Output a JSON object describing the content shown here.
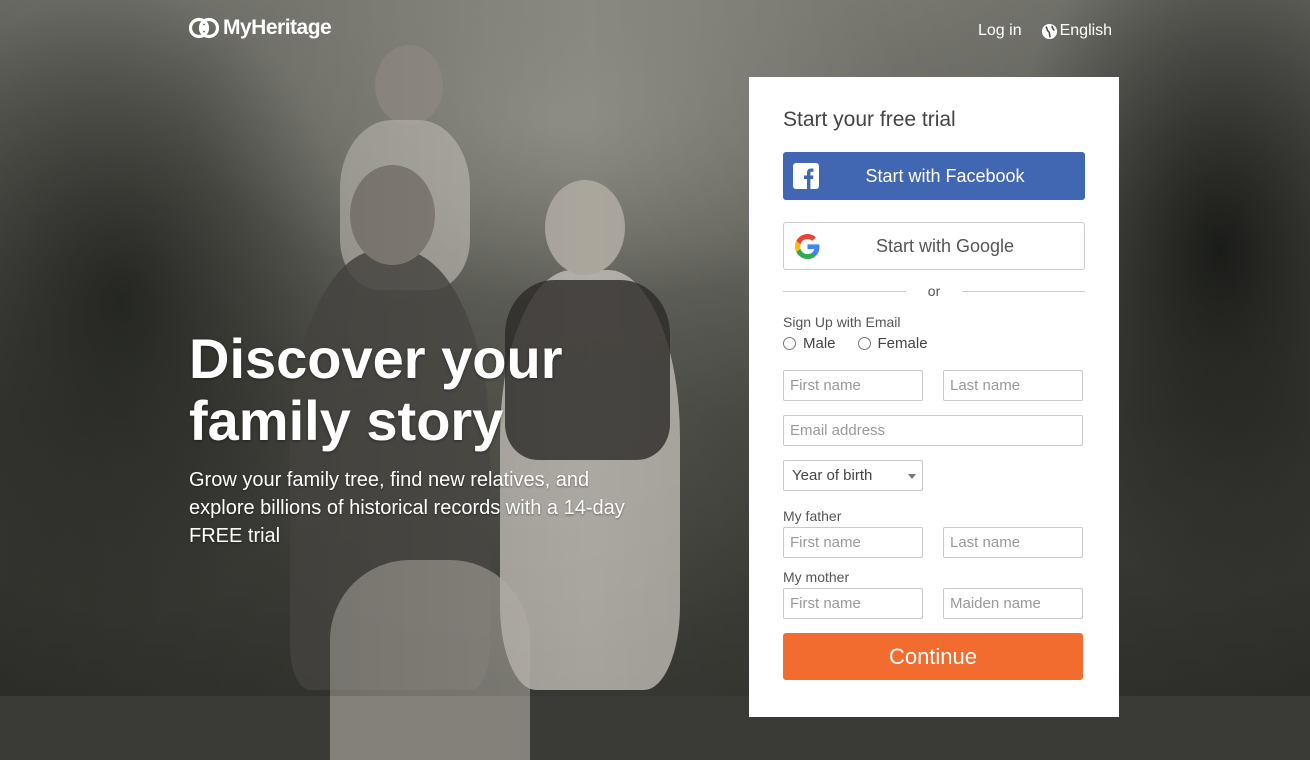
{
  "header": {
    "logo_text": "MyHeritage",
    "login_label": "Log in",
    "language_label": "English"
  },
  "hero": {
    "title": "Discover your family story",
    "subtitle": "Grow your family tree, find new relatives, and explore billions of historical records with a 14-day FREE trial"
  },
  "signup": {
    "title": "Start your free trial",
    "facebook_label": "Start with Facebook",
    "google_label": "Start with Google",
    "or_label": "or",
    "email_section_label": "Sign Up with Email",
    "gender_options": [
      "Male",
      "Female"
    ],
    "first_name_placeholder": "First name",
    "last_name_placeholder": "Last name",
    "email_placeholder": "Email address",
    "year_of_birth_label": "Year of birth",
    "father_label": "My father",
    "father_first_placeholder": "First name",
    "father_last_placeholder": "Last name",
    "mother_label": "My mother",
    "mother_first_placeholder": "First name",
    "mother_maiden_placeholder": "Maiden name",
    "continue_label": "Continue"
  },
  "colors": {
    "facebook": "#4267b2",
    "continue": "#f26b2f"
  },
  "icons": {
    "logo": "myheritage-logo-icon",
    "language": "globe-icon",
    "facebook": "facebook-icon",
    "google": "google-icon",
    "select": "chevron-down-icon"
  }
}
